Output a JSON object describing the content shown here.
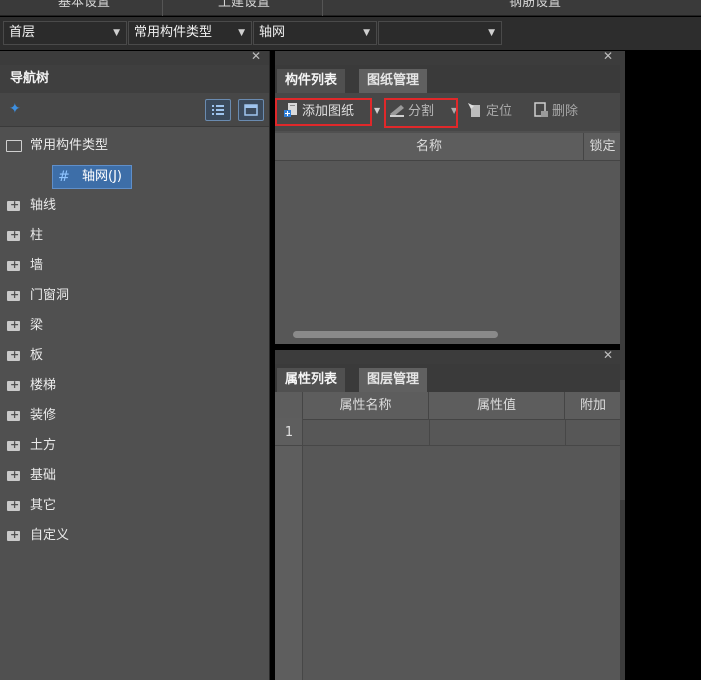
{
  "ribbon": {
    "tabs": [
      "基本设置",
      "土建设置",
      "钢筋设置"
    ]
  },
  "dropdowns": [
    {
      "value": "首层"
    },
    {
      "value": "常用构件类型"
    },
    {
      "value": "轴网"
    },
    {
      "value": ""
    }
  ],
  "nav": {
    "title": "导航树",
    "root": "常用构件类型",
    "selected": "轴网(J)",
    "items": [
      "轴线",
      "柱",
      "墙",
      "门窗洞",
      "梁",
      "板",
      "楼梯",
      "装修",
      "土方",
      "基础",
      "其它",
      "自定义"
    ]
  },
  "component_panel": {
    "tabs": [
      "构件列表",
      "图纸管理"
    ],
    "tools": {
      "add": "添加图纸",
      "split": "分割",
      "locate": "定位",
      "delete": "删除"
    },
    "columns": [
      "名称",
      "锁定"
    ]
  },
  "property_panel": {
    "tabs": [
      "属性列表",
      "图层管理"
    ],
    "columns": [
      "属性名称",
      "属性值",
      "附加"
    ],
    "rows": [
      "1"
    ]
  },
  "colors": {
    "accent": "#3d6ea8",
    "highlight_border": "#e0282a",
    "panel_bg": "#505050"
  }
}
